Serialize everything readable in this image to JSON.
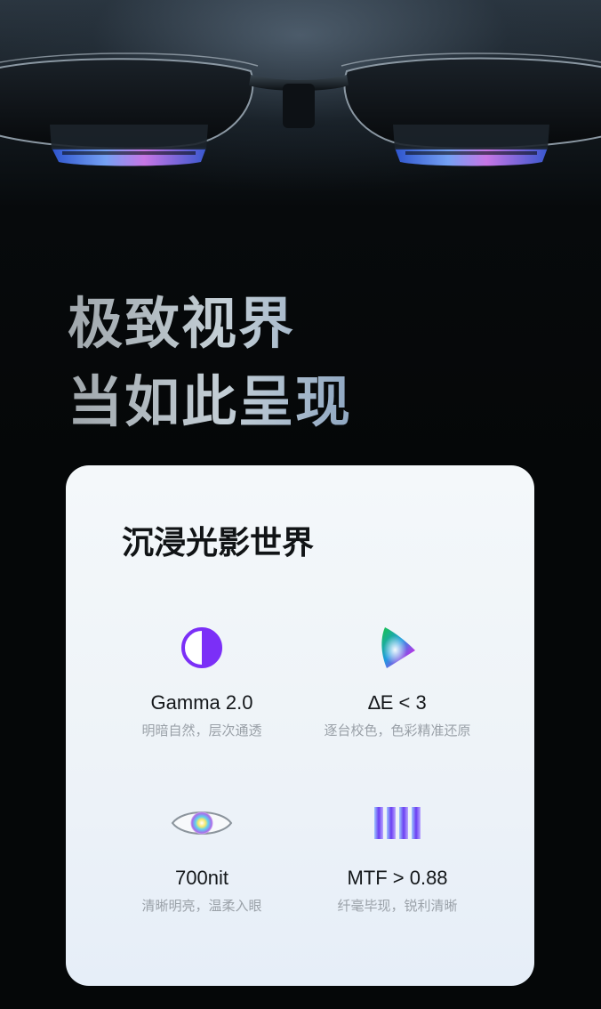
{
  "hero": {
    "headline_line1": "极致视界",
    "headline_line2": "当如此呈现"
  },
  "card": {
    "title": "沉浸光影世界",
    "features": [
      {
        "icon": "contrast-circle-icon",
        "label": "Gamma 2.0",
        "desc": "明暗自然，层次通透"
      },
      {
        "icon": "color-gamut-triangle-icon",
        "label": "∆E < 3",
        "desc": "逐台校色，色彩精准还原"
      },
      {
        "icon": "eye-icon",
        "label": "700nit",
        "desc": "清晰明亮，温柔入眼"
      },
      {
        "icon": "resolution-bars-icon",
        "label": "MTF > 0.88",
        "desc": "纤毫毕现，锐利清晰"
      }
    ]
  },
  "colors": {
    "accent_purple": "#7b2ff7",
    "card_background": "#eef3f8",
    "page_background": "#050708"
  }
}
